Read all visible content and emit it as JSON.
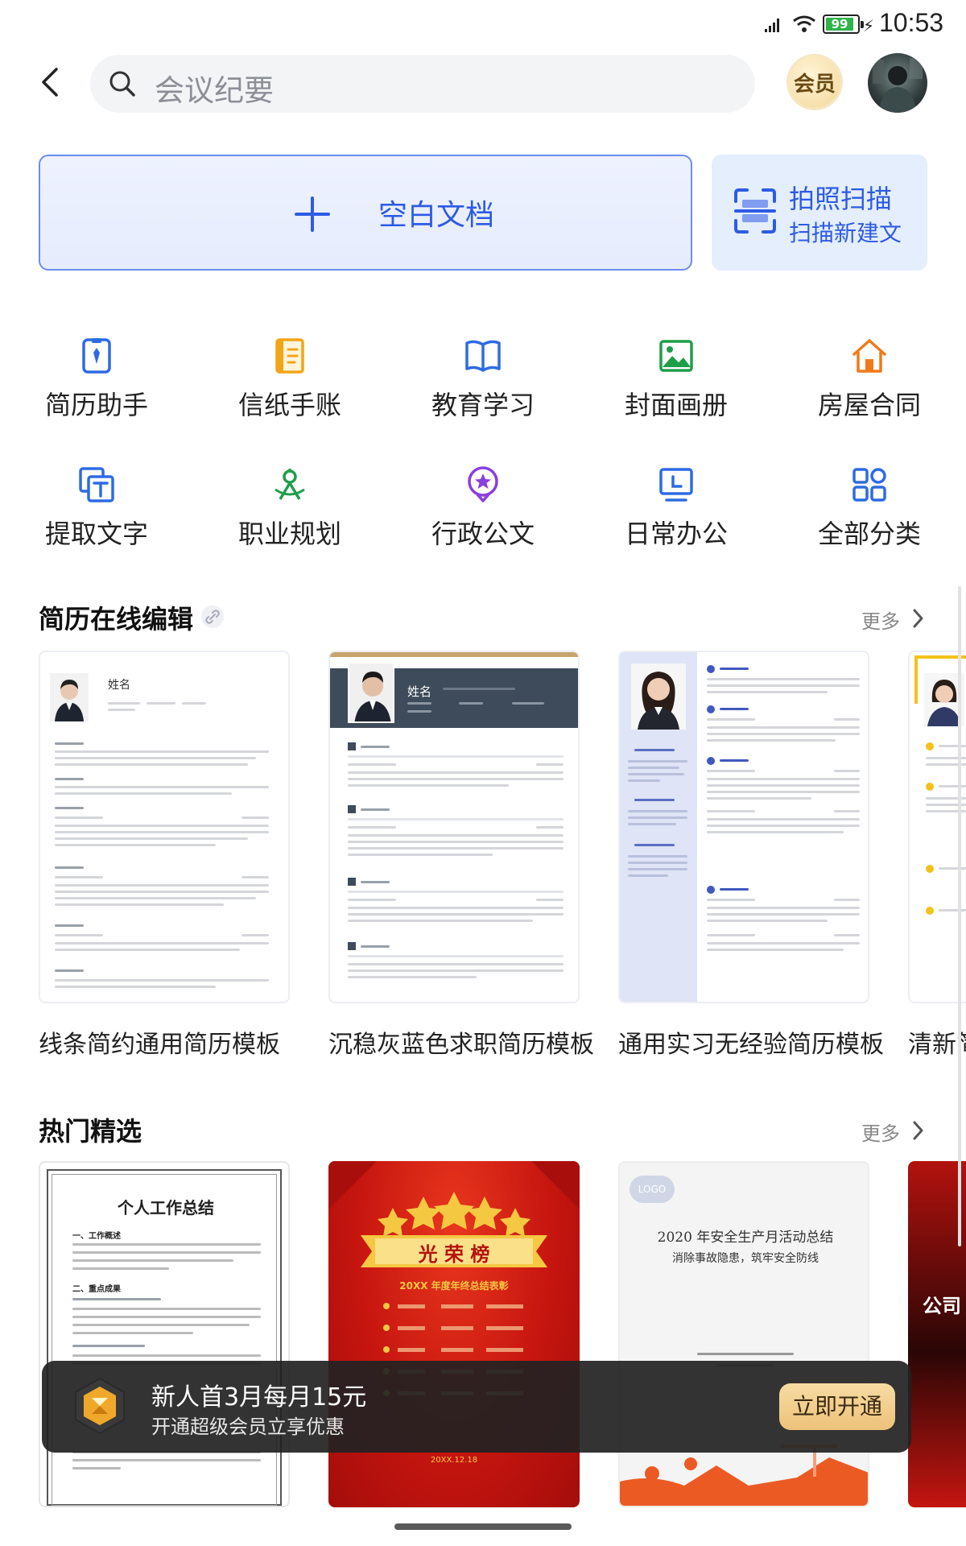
{
  "status_bar": {
    "time": "10:53",
    "battery": "99"
  },
  "search": {
    "placeholder": "会议纪要"
  },
  "header": {
    "vip_label": "会员"
  },
  "actions": {
    "blank_doc": "空白文档",
    "scan_title": "拍照扫描",
    "scan_subtitle": "扫描新建文"
  },
  "categories": [
    {
      "label": "简历助手",
      "icon": "resume-icon",
      "color": "#2d6be4"
    },
    {
      "label": "信纸手账",
      "icon": "notebook-icon",
      "color": "#f2a516"
    },
    {
      "label": "教育学习",
      "icon": "book-icon",
      "color": "#2d6be4"
    },
    {
      "label": "封面画册",
      "icon": "image-icon",
      "color": "#1f9e4a"
    },
    {
      "label": "房屋合同",
      "icon": "house-icon",
      "color": "#f07a1a"
    },
    {
      "label": "提取文字",
      "icon": "extract-text-icon",
      "color": "#2d6be4"
    },
    {
      "label": "职业规划",
      "icon": "career-icon",
      "color": "#1f9e4a"
    },
    {
      "label": "行政公文",
      "icon": "badge-star-icon",
      "color": "#8a3ee0"
    },
    {
      "label": "日常办公",
      "icon": "monitor-icon",
      "color": "#2d6be4"
    },
    {
      "label": "全部分类",
      "icon": "grid-icon",
      "color": "#2d6be4"
    }
  ],
  "resume_section": {
    "title": "简历在线编辑",
    "more": "更多",
    "templates": [
      {
        "title": "线条简约通用简历模板",
        "name": "姓名"
      },
      {
        "title": "沉稳灰蓝色求职简历模板",
        "name": "姓名"
      },
      {
        "title": "通用实习无经验简历模板"
      },
      {
        "title": "清新简"
      }
    ]
  },
  "hot_section": {
    "title": "热门精选",
    "more": "更多",
    "items": [
      {
        "heading": "个人工作总结",
        "sub1": "一、工作概述",
        "sub2": "二、重点成果"
      },
      {
        "banner": "光 荣 榜",
        "subtitle": "20XX 年度年终总结表彰",
        "date": "20XX.12.18"
      },
      {
        "logo": "LOGO",
        "title": "2020 年安全生产月活动总结",
        "subtitle": "消除事故隐患，筑牢安全防线"
      },
      {
        "text": "公司"
      }
    ]
  },
  "promo": {
    "title": "新人首3月每月15元",
    "subtitle": "开通超级会员立享优惠",
    "button": "立即开通"
  }
}
